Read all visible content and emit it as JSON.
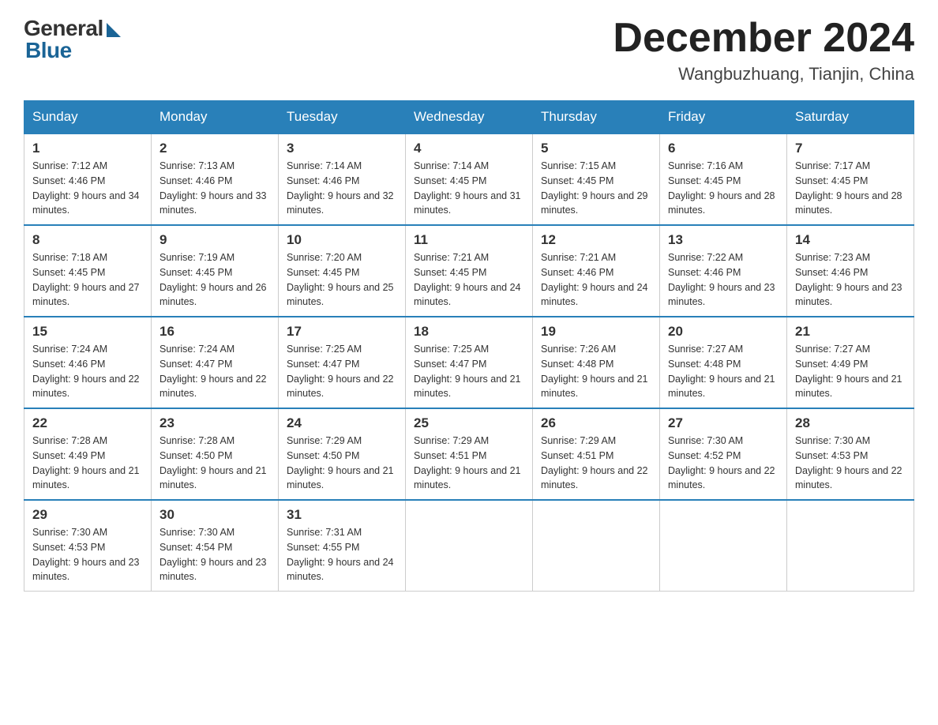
{
  "logo": {
    "general": "General",
    "blue": "Blue"
  },
  "title": "December 2024",
  "location": "Wangbuzhuang, Tianjin, China",
  "days_of_week": [
    "Sunday",
    "Monday",
    "Tuesday",
    "Wednesday",
    "Thursday",
    "Friday",
    "Saturday"
  ],
  "weeks": [
    [
      {
        "day": "1",
        "sunrise": "7:12 AM",
        "sunset": "4:46 PM",
        "daylight": "9 hours and 34 minutes."
      },
      {
        "day": "2",
        "sunrise": "7:13 AM",
        "sunset": "4:46 PM",
        "daylight": "9 hours and 33 minutes."
      },
      {
        "day": "3",
        "sunrise": "7:14 AM",
        "sunset": "4:46 PM",
        "daylight": "9 hours and 32 minutes."
      },
      {
        "day": "4",
        "sunrise": "7:14 AM",
        "sunset": "4:45 PM",
        "daylight": "9 hours and 31 minutes."
      },
      {
        "day": "5",
        "sunrise": "7:15 AM",
        "sunset": "4:45 PM",
        "daylight": "9 hours and 29 minutes."
      },
      {
        "day": "6",
        "sunrise": "7:16 AM",
        "sunset": "4:45 PM",
        "daylight": "9 hours and 28 minutes."
      },
      {
        "day": "7",
        "sunrise": "7:17 AM",
        "sunset": "4:45 PM",
        "daylight": "9 hours and 28 minutes."
      }
    ],
    [
      {
        "day": "8",
        "sunrise": "7:18 AM",
        "sunset": "4:45 PM",
        "daylight": "9 hours and 27 minutes."
      },
      {
        "day": "9",
        "sunrise": "7:19 AM",
        "sunset": "4:45 PM",
        "daylight": "9 hours and 26 minutes."
      },
      {
        "day": "10",
        "sunrise": "7:20 AM",
        "sunset": "4:45 PM",
        "daylight": "9 hours and 25 minutes."
      },
      {
        "day": "11",
        "sunrise": "7:21 AM",
        "sunset": "4:45 PM",
        "daylight": "9 hours and 24 minutes."
      },
      {
        "day": "12",
        "sunrise": "7:21 AM",
        "sunset": "4:46 PM",
        "daylight": "9 hours and 24 minutes."
      },
      {
        "day": "13",
        "sunrise": "7:22 AM",
        "sunset": "4:46 PM",
        "daylight": "9 hours and 23 minutes."
      },
      {
        "day": "14",
        "sunrise": "7:23 AM",
        "sunset": "4:46 PM",
        "daylight": "9 hours and 23 minutes."
      }
    ],
    [
      {
        "day": "15",
        "sunrise": "7:24 AM",
        "sunset": "4:46 PM",
        "daylight": "9 hours and 22 minutes."
      },
      {
        "day": "16",
        "sunrise": "7:24 AM",
        "sunset": "4:47 PM",
        "daylight": "9 hours and 22 minutes."
      },
      {
        "day": "17",
        "sunrise": "7:25 AM",
        "sunset": "4:47 PM",
        "daylight": "9 hours and 22 minutes."
      },
      {
        "day": "18",
        "sunrise": "7:25 AM",
        "sunset": "4:47 PM",
        "daylight": "9 hours and 21 minutes."
      },
      {
        "day": "19",
        "sunrise": "7:26 AM",
        "sunset": "4:48 PM",
        "daylight": "9 hours and 21 minutes."
      },
      {
        "day": "20",
        "sunrise": "7:27 AM",
        "sunset": "4:48 PM",
        "daylight": "9 hours and 21 minutes."
      },
      {
        "day": "21",
        "sunrise": "7:27 AM",
        "sunset": "4:49 PM",
        "daylight": "9 hours and 21 minutes."
      }
    ],
    [
      {
        "day": "22",
        "sunrise": "7:28 AM",
        "sunset": "4:49 PM",
        "daylight": "9 hours and 21 minutes."
      },
      {
        "day": "23",
        "sunrise": "7:28 AM",
        "sunset": "4:50 PM",
        "daylight": "9 hours and 21 minutes."
      },
      {
        "day": "24",
        "sunrise": "7:29 AM",
        "sunset": "4:50 PM",
        "daylight": "9 hours and 21 minutes."
      },
      {
        "day": "25",
        "sunrise": "7:29 AM",
        "sunset": "4:51 PM",
        "daylight": "9 hours and 21 minutes."
      },
      {
        "day": "26",
        "sunrise": "7:29 AM",
        "sunset": "4:51 PM",
        "daylight": "9 hours and 22 minutes."
      },
      {
        "day": "27",
        "sunrise": "7:30 AM",
        "sunset": "4:52 PM",
        "daylight": "9 hours and 22 minutes."
      },
      {
        "day": "28",
        "sunrise": "7:30 AM",
        "sunset": "4:53 PM",
        "daylight": "9 hours and 22 minutes."
      }
    ],
    [
      {
        "day": "29",
        "sunrise": "7:30 AM",
        "sunset": "4:53 PM",
        "daylight": "9 hours and 23 minutes."
      },
      {
        "day": "30",
        "sunrise": "7:30 AM",
        "sunset": "4:54 PM",
        "daylight": "9 hours and 23 minutes."
      },
      {
        "day": "31",
        "sunrise": "7:31 AM",
        "sunset": "4:55 PM",
        "daylight": "9 hours and 24 minutes."
      },
      null,
      null,
      null,
      null
    ]
  ]
}
